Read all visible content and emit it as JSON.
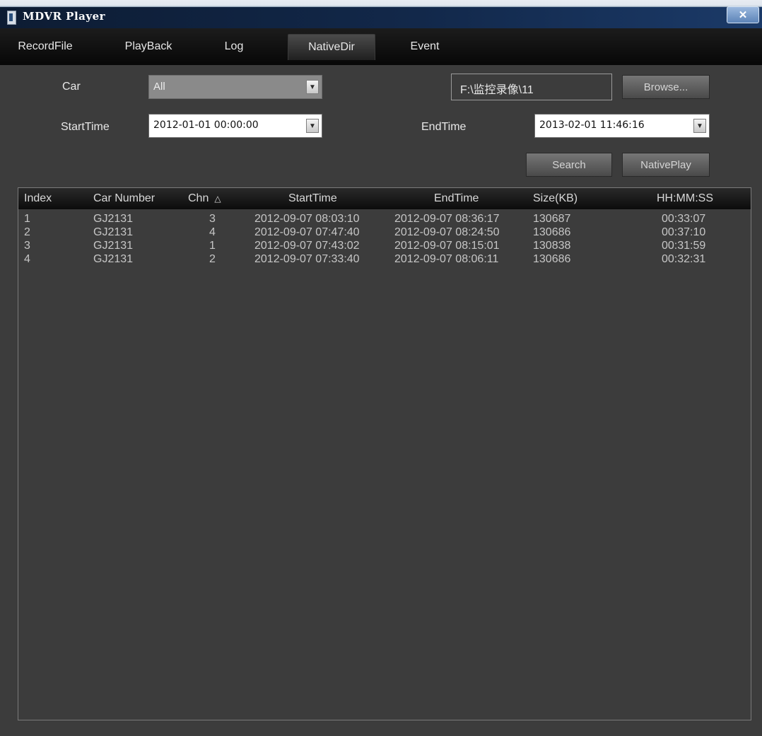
{
  "window": {
    "title": "MDVR Player",
    "close_glyph": "✕"
  },
  "tabs": [
    {
      "label": "RecordFile",
      "active": false
    },
    {
      "label": "PlayBack",
      "active": false
    },
    {
      "label": "Log",
      "active": false
    },
    {
      "label": "NativeDir",
      "active": true
    },
    {
      "label": "Event",
      "active": false
    }
  ],
  "form": {
    "car_label": "Car",
    "car_value": "All",
    "path_value": "F:\\监控录像\\11",
    "browse_label": "Browse...",
    "start_label": "StartTime",
    "start_value": "2012-01-01 00:00:00",
    "end_label": "EndTime",
    "end_value": "2013-02-01 11:46:16",
    "search_label": "Search",
    "nativeplay_label": "NativePlay",
    "dropdown_icon": "chevron-down-icon"
  },
  "table": {
    "columns": [
      "Index",
      "Car Number",
      "Chn",
      "StartTime",
      "EndTime",
      "Size(KB)",
      "HH:MM:SS"
    ],
    "sort_glyph": "△",
    "rows": [
      [
        "1",
        "GJ2131",
        "3",
        "2012-09-07 08:03:10",
        "2012-09-07 08:36:17",
        "130687",
        "00:33:07"
      ],
      [
        "2",
        "GJ2131",
        "4",
        "2012-09-07 07:47:40",
        "2012-09-07 08:24:50",
        "130686",
        "00:37:10"
      ],
      [
        "3",
        "GJ2131",
        "1",
        "2012-09-07 07:43:02",
        "2012-09-07 08:15:01",
        "130838",
        "00:31:59"
      ],
      [
        "4",
        "GJ2131",
        "2",
        "2012-09-07 07:33:40",
        "2012-09-07 08:06:11",
        "130686",
        "00:32:31"
      ]
    ]
  },
  "colors": {
    "background": "#3c3c3c",
    "tabbar": "#0b0b0b",
    "titlebar": "#12284a"
  }
}
